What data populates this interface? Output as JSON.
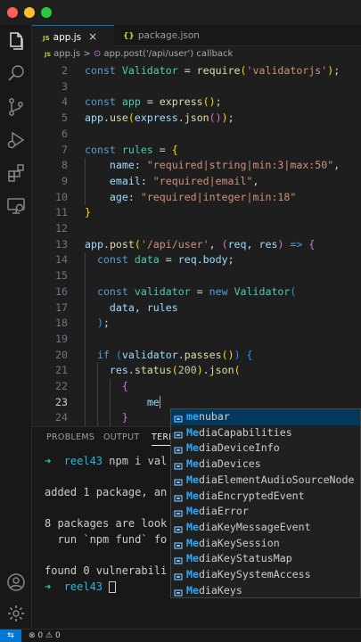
{
  "window": {
    "controls": [
      "close",
      "minimize",
      "maximize"
    ],
    "control_colors": [
      "#ff5f57",
      "#febc2e",
      "#28c840"
    ]
  },
  "activity_bar": {
    "top_icons": [
      "files-icon",
      "search-icon",
      "source-control-icon",
      "run-debug-icon",
      "extensions-icon",
      "remote-explorer-icon"
    ],
    "bottom_icons": [
      "account-icon",
      "settings-gear-icon"
    ]
  },
  "tabs": [
    {
      "icon": "JS",
      "label": "app.js",
      "close": "×",
      "active": true
    },
    {
      "icon": "{}",
      "label": "package.json",
      "active": false
    }
  ],
  "breadcrumb": {
    "file_icon": "JS",
    "file": "app.js",
    "separator": ">",
    "symbol": "app.post('/api/user') callback"
  },
  "editor": {
    "lines": [
      {
        "n": "2",
        "segs": [
          [
            "k",
            "const "
          ],
          [
            "c",
            "Validator"
          ],
          [
            "p",
            " = "
          ],
          [
            "f",
            "require"
          ],
          [
            "b1",
            "("
          ],
          [
            "s",
            "'validatorjs'"
          ],
          [
            "b1",
            ")"
          ],
          [
            "p",
            ";"
          ]
        ]
      },
      {
        "n": "3",
        "segs": []
      },
      {
        "n": "4",
        "segs": [
          [
            "k",
            "const "
          ],
          [
            "c",
            "app"
          ],
          [
            "p",
            " = "
          ],
          [
            "f",
            "express"
          ],
          [
            "b1",
            "()"
          ],
          [
            "p",
            ";"
          ]
        ]
      },
      {
        "n": "5",
        "segs": [
          [
            "v",
            "app"
          ],
          [
            "p",
            "."
          ],
          [
            "f",
            "use"
          ],
          [
            "b1",
            "("
          ],
          [
            "v",
            "express"
          ],
          [
            "p",
            "."
          ],
          [
            "f",
            "json"
          ],
          [
            "b2",
            "()"
          ],
          [
            "b1",
            ")"
          ],
          [
            "p",
            ";"
          ]
        ]
      },
      {
        "n": "6",
        "segs": []
      },
      {
        "n": "7",
        "segs": [
          [
            "k",
            "const "
          ],
          [
            "c",
            "rules"
          ],
          [
            "p",
            " = "
          ],
          [
            "b1",
            "{"
          ]
        ]
      },
      {
        "n": "8",
        "segs": [
          [
            "p",
            "    "
          ],
          [
            "v",
            "name"
          ],
          [
            "p",
            ": "
          ],
          [
            "s",
            "\"required|string|min:3|max:50\""
          ],
          [
            "p",
            ","
          ]
        ]
      },
      {
        "n": "9",
        "segs": [
          [
            "p",
            "    "
          ],
          [
            "v",
            "email"
          ],
          [
            "p",
            ": "
          ],
          [
            "s",
            "\"required|email\""
          ],
          [
            "p",
            ","
          ]
        ]
      },
      {
        "n": "10",
        "segs": [
          [
            "p",
            "    "
          ],
          [
            "v",
            "age"
          ],
          [
            "p",
            ": "
          ],
          [
            "s",
            "\"required|integer|min:18\""
          ]
        ]
      },
      {
        "n": "11",
        "segs": [
          [
            "b1",
            "}"
          ]
        ]
      },
      {
        "n": "12",
        "segs": []
      },
      {
        "n": "13",
        "segs": [
          [
            "v",
            "app"
          ],
          [
            "p",
            "."
          ],
          [
            "f",
            "post"
          ],
          [
            "b1",
            "("
          ],
          [
            "s",
            "'/api/user'"
          ],
          [
            "p",
            ", "
          ],
          [
            "b2",
            "("
          ],
          [
            "v",
            "req"
          ],
          [
            "p",
            ", "
          ],
          [
            "v",
            "res"
          ],
          [
            "b2",
            ")"
          ],
          [
            "k",
            " => "
          ],
          [
            "b2",
            "{"
          ]
        ]
      },
      {
        "n": "14",
        "segs": [
          [
            "p",
            "  "
          ],
          [
            "k",
            "const "
          ],
          [
            "c",
            "data"
          ],
          [
            "p",
            " = "
          ],
          [
            "v",
            "req"
          ],
          [
            "p",
            "."
          ],
          [
            "v",
            "body"
          ],
          [
            "p",
            ";"
          ]
        ]
      },
      {
        "n": "15",
        "segs": []
      },
      {
        "n": "16",
        "segs": [
          [
            "p",
            "  "
          ],
          [
            "k",
            "const "
          ],
          [
            "c",
            "validator"
          ],
          [
            "p",
            " = "
          ],
          [
            "k",
            "new "
          ],
          [
            "c",
            "Validator"
          ],
          [
            "b3",
            "("
          ]
        ]
      },
      {
        "n": "17",
        "segs": [
          [
            "p",
            "    "
          ],
          [
            "v",
            "data"
          ],
          [
            "p",
            ", "
          ],
          [
            "v",
            "rules"
          ]
        ]
      },
      {
        "n": "18",
        "segs": [
          [
            "p",
            "  "
          ],
          [
            "b3",
            ")"
          ],
          [
            "p",
            ";"
          ]
        ]
      },
      {
        "n": "19",
        "segs": []
      },
      {
        "n": "20",
        "segs": [
          [
            "p",
            "  "
          ],
          [
            "k",
            "if "
          ],
          [
            "b3",
            "("
          ],
          [
            "v",
            "validator"
          ],
          [
            "p",
            "."
          ],
          [
            "f",
            "passes"
          ],
          [
            "b1",
            "()"
          ],
          [
            "b3",
            ")"
          ],
          [
            "p",
            " "
          ],
          [
            "b3",
            "{"
          ]
        ]
      },
      {
        "n": "21",
        "segs": [
          [
            "p",
            "    "
          ],
          [
            "v",
            "res"
          ],
          [
            "p",
            "."
          ],
          [
            "f",
            "status"
          ],
          [
            "b1",
            "("
          ],
          [
            "n",
            "200"
          ],
          [
            "b1",
            ")"
          ],
          [
            "p",
            "."
          ],
          [
            "f",
            "json"
          ],
          [
            "b1",
            "("
          ]
        ]
      },
      {
        "n": "22",
        "segs": [
          [
            "p",
            "      "
          ],
          [
            "b2",
            "{"
          ]
        ]
      },
      {
        "n": "23",
        "segs": [
          [
            "p",
            "          "
          ],
          [
            "v",
            "me"
          ]
        ],
        "cursor": true,
        "current": true
      },
      {
        "n": "24",
        "segs": [
          [
            "p",
            "      "
          ],
          [
            "b2",
            "}"
          ]
        ]
      }
    ]
  },
  "panel": {
    "tabs": [
      "PROBLEMS",
      "OUTPUT",
      "TERM"
    ],
    "active_tab": "TERM"
  },
  "terminal": {
    "lines": [
      {
        "prompt": "➜",
        "dir": "reel43",
        "text": " npm i val"
      },
      {
        "text": ""
      },
      {
        "text": "added 1 package, an"
      },
      {
        "text": ""
      },
      {
        "text": "8 packages are look"
      },
      {
        "text": "  run `npm fund` fo"
      },
      {
        "text": ""
      },
      {
        "text": "found 0 vulnerabili"
      },
      {
        "prompt": "➜",
        "dir": "reel43",
        "text": " ",
        "cursor": true
      }
    ]
  },
  "suggest": {
    "query": "me",
    "items": [
      {
        "label": "menubar",
        "kind": "variable",
        "selected": true
      },
      {
        "label": "MediaCapabilities",
        "kind": "variable"
      },
      {
        "label": "MediaDeviceInfo",
        "kind": "variable"
      },
      {
        "label": "MediaDevices",
        "kind": "variable"
      },
      {
        "label": "MediaElementAudioSourceNode",
        "kind": "variable"
      },
      {
        "label": "MediaEncryptedEvent",
        "kind": "variable"
      },
      {
        "label": "MediaError",
        "kind": "variable"
      },
      {
        "label": "MediaKeyMessageEvent",
        "kind": "variable"
      },
      {
        "label": "MediaKeySession",
        "kind": "variable"
      },
      {
        "label": "MediaKeyStatusMap",
        "kind": "variable"
      },
      {
        "label": "MediaKeySystemAccess",
        "kind": "variable"
      },
      {
        "label": "MediaKeys",
        "kind": "variable"
      }
    ]
  },
  "status_bar": {
    "remote": "⇆",
    "errors": "0",
    "warnings": "0"
  }
}
